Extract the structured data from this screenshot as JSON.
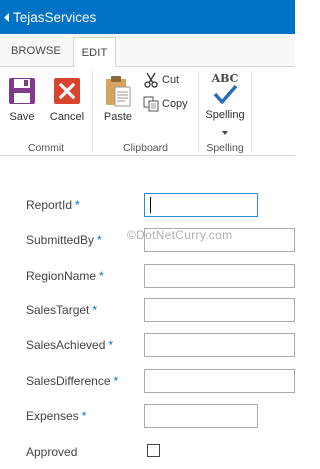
{
  "window": {
    "title": "TejasServices"
  },
  "tabs": [
    {
      "label": "BROWSE"
    },
    {
      "label": "EDIT"
    }
  ],
  "ribbon": {
    "commit": {
      "group_label": "Commit",
      "save_label": "Save",
      "cancel_label": "Cancel"
    },
    "clipboard": {
      "group_label": "Clipboard",
      "paste_label": "Paste",
      "cut_label": "Cut",
      "copy_label": "Copy"
    },
    "spelling": {
      "group_label": "Spelling",
      "spelling_label": "Spelling",
      "abc_text": "ABC"
    }
  },
  "form": {
    "required_marker": "*",
    "fields": [
      {
        "label": "ReportId",
        "value": ""
      },
      {
        "label": "SubmittedBy",
        "value": ""
      },
      {
        "label": "RegionName",
        "value": ""
      },
      {
        "label": "SalesTarget",
        "value": ""
      },
      {
        "label": "SalesAchieved",
        "value": ""
      },
      {
        "label": "SalesDifference",
        "value": ""
      },
      {
        "label": "Expenses",
        "value": ""
      },
      {
        "label": "Approved",
        "checked": false
      }
    ]
  },
  "watermark": "©DotNetCurry.com",
  "colors": {
    "accent": "#0072c6",
    "cancel_red": "#d9442e",
    "save_purple": "#7e3b8a"
  }
}
